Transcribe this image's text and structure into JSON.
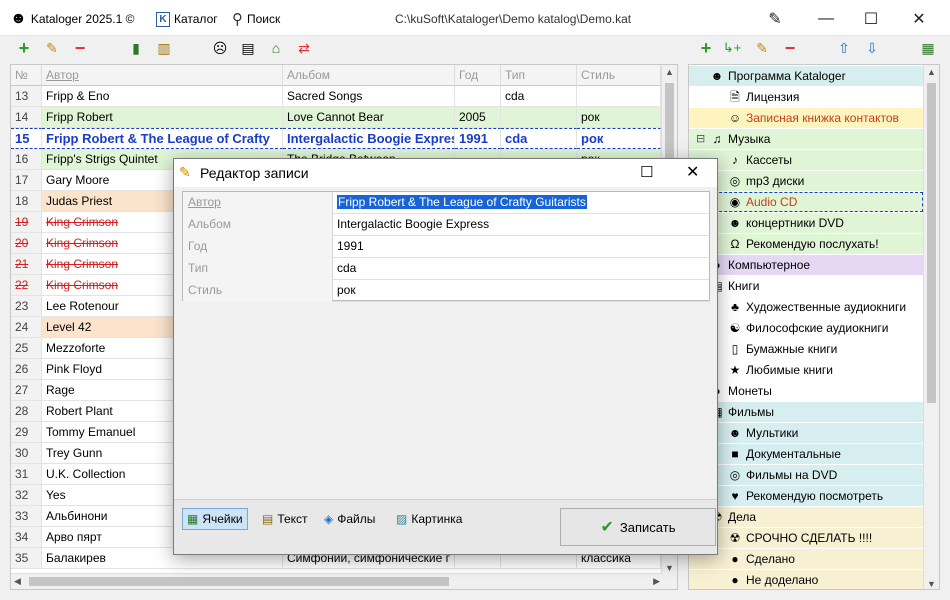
{
  "titlebar": {
    "app_name": "Kataloger 2025.1 ©",
    "catalog_label": "Каталог",
    "search_label": "Поиск",
    "path": "C:\\kuSoft\\Kataloger\\Demo katalog\\Demo.kat"
  },
  "grid": {
    "columns": [
      "№",
      "Автор",
      "Альбом",
      "Год",
      "Тип",
      "Стиль"
    ],
    "rows": [
      {
        "n": "13",
        "author": "Fripp & Eno",
        "album": "Sacred Songs",
        "year": "",
        "type": "cda",
        "style": "",
        "bg": "#ffffff",
        "strike": false
      },
      {
        "n": "14",
        "author": "Fripp Robert",
        "album": "Love Cannot Bear",
        "year": "2005",
        "type": "",
        "style": "рок",
        "bg": "#dff5d6",
        "strike": false
      },
      {
        "n": "15",
        "author": "Fripp Robert & The League of Crafty",
        "album": "Intergalactic Boogie Expres",
        "year": "1991",
        "type": "cda",
        "style": "рок",
        "bg": "#ffffff",
        "strike": false,
        "current": true
      },
      {
        "n": "16",
        "author": "Fripp's Strigs Quintet",
        "album": "The Bridge Between",
        "year": "",
        "type": "",
        "style": "рок",
        "bg": "#dff5d6",
        "strike": false
      },
      {
        "n": "17",
        "author": "Gary Moore",
        "album": "",
        "year": "",
        "type": "",
        "style": "",
        "bg": "#ffffff",
        "strike": false
      },
      {
        "n": "18",
        "author": "Judas Priest",
        "album": "",
        "year": "",
        "type": "",
        "style": "",
        "bg": "#fbe3cc",
        "strike": false
      },
      {
        "n": "19",
        "author": "King Crimson",
        "album": "",
        "year": "",
        "type": "",
        "style": "",
        "bg": "#ffffff",
        "strike": true
      },
      {
        "n": "20",
        "author": "King Crimson",
        "album": "",
        "year": "",
        "type": "",
        "style": "",
        "bg": "#ffffff",
        "strike": true
      },
      {
        "n": "21",
        "author": "King Crimson",
        "album": "",
        "year": "",
        "type": "",
        "style": "",
        "bg": "#ffffff",
        "strike": true
      },
      {
        "n": "22",
        "author": "King Crimson",
        "album": "",
        "year": "",
        "type": "",
        "style": "",
        "bg": "#ffffff",
        "strike": true
      },
      {
        "n": "23",
        "author": "Lee Rotenour",
        "album": "",
        "year": "",
        "type": "",
        "style": "",
        "bg": "#ffffff",
        "strike": false
      },
      {
        "n": "24",
        "author": "Level 42",
        "album": "",
        "year": "",
        "type": "",
        "style": "",
        "bg": "#fbe3cc",
        "strike": false
      },
      {
        "n": "25",
        "author": "Mezzoforte",
        "album": "",
        "year": "",
        "type": "",
        "style": "",
        "bg": "#ffffff",
        "strike": false
      },
      {
        "n": "26",
        "author": "Pink Floyd",
        "album": "",
        "year": "",
        "type": "",
        "style": "",
        "bg": "#ffffff",
        "strike": false
      },
      {
        "n": "27",
        "author": "Rage",
        "album": "",
        "year": "",
        "type": "",
        "style": "",
        "bg": "#ffffff",
        "strike": false
      },
      {
        "n": "28",
        "author": "Robert Plant",
        "album": "",
        "year": "",
        "type": "",
        "style": "",
        "bg": "#ffffff",
        "strike": false
      },
      {
        "n": "29",
        "author": "Tommy Emanuel",
        "album": "",
        "year": "",
        "type": "",
        "style": "",
        "bg": "#ffffff",
        "strike": false
      },
      {
        "n": "30",
        "author": "Trey Gunn",
        "album": "",
        "year": "",
        "type": "",
        "style": "",
        "bg": "#ffffff",
        "strike": false
      },
      {
        "n": "31",
        "author": "U.K. Collection",
        "album": "",
        "year": "",
        "type": "",
        "style": "",
        "bg": "#ffffff",
        "strike": false
      },
      {
        "n": "32",
        "author": "Yes",
        "album": "",
        "year": "",
        "type": "",
        "style": "",
        "bg": "#ffffff",
        "strike": false
      },
      {
        "n": "33",
        "author": "Альбинони",
        "album": "",
        "year": "",
        "type": "",
        "style": "",
        "bg": "#ffffff",
        "strike": false
      },
      {
        "n": "34",
        "author": "Арво пярт",
        "album": "",
        "year": "",
        "type": "",
        "style": "",
        "bg": "#ffffff",
        "strike": false
      },
      {
        "n": "35",
        "author": "Балакирев",
        "album": "Симфонии, симфонические г Евгени 2 CD",
        "year": "",
        "type": "",
        "style": "классика",
        "bg": "#ffffff",
        "strike": false
      }
    ]
  },
  "tree": {
    "nodes": [
      {
        "label": "Программа Kataloger",
        "level": 0,
        "icon": "smiley-icon",
        "glyph": "☻",
        "bg": "#d6eef0",
        "color": "#000",
        "expander": ""
      },
      {
        "label": "Лицензия",
        "level": 1,
        "icon": "document-icon",
        "glyph": "🗎",
        "bg": "#ffffff",
        "color": "#000",
        "expander": ""
      },
      {
        "label": "Записная книжка контактов",
        "level": 1,
        "icon": "contact-icon",
        "glyph": "☺",
        "bg": "#fdf4c0",
        "color": "#c5401b",
        "expander": ""
      },
      {
        "label": "Музыка",
        "level": 0,
        "icon": "music-icon",
        "glyph": "♫",
        "bg": "#dff5d6",
        "color": "#000",
        "expander": "⊟"
      },
      {
        "label": "Кассеты",
        "level": 1,
        "icon": "cassette-icon",
        "glyph": "♪",
        "bg": "#dff5d6",
        "color": "#000",
        "expander": ""
      },
      {
        "label": "mp3 диски",
        "level": 1,
        "icon": "disc-icon",
        "glyph": "◎",
        "bg": "#dff5d6",
        "color": "#000",
        "expander": ""
      },
      {
        "label": "Audio CD",
        "level": 1,
        "icon": "cd-icon",
        "glyph": "◉",
        "bg": "#dff5d6",
        "color": "#c5401b",
        "expander": "",
        "selected": true
      },
      {
        "label": "концертники DVD",
        "level": 1,
        "icon": "dvd-icon",
        "glyph": "☻",
        "bg": "#dff5d6",
        "color": "#000",
        "expander": ""
      },
      {
        "label": "Рекомендую послухать!",
        "level": 1,
        "icon": "headphones-icon",
        "glyph": "Ω",
        "bg": "#dff5d6",
        "color": "#000",
        "expander": ""
      },
      {
        "label": "Компьютерное",
        "level": 0,
        "icon": "computer-icon",
        "glyph": "●",
        "bg": "#e6d8f5",
        "color": "#000",
        "expander": ""
      },
      {
        "label": "Книги",
        "level": 0,
        "icon": "books-icon",
        "glyph": "▤",
        "bg": "#ffffff",
        "color": "#000",
        "expander": ""
      },
      {
        "label": "Художественные аудиокниги",
        "level": 1,
        "icon": "tree-icon",
        "glyph": "♣",
        "bg": "#ffffff",
        "color": "#000",
        "expander": ""
      },
      {
        "label": "Философские аудиокниги",
        "level": 1,
        "icon": "philosophy-icon",
        "glyph": "☯",
        "bg": "#ffffff",
        "color": "#000",
        "expander": ""
      },
      {
        "label": "Бумажные книги",
        "level": 1,
        "icon": "paper-book-icon",
        "glyph": "▯",
        "bg": "#ffffff",
        "color": "#000",
        "expander": ""
      },
      {
        "label": "Любимые книги",
        "level": 1,
        "icon": "star-icon",
        "glyph": "★",
        "bg": "#ffffff",
        "color": "#000",
        "expander": ""
      },
      {
        "label": "Монеты",
        "level": 0,
        "icon": "coin-icon",
        "glyph": "●",
        "bg": "#ffffff",
        "color": "#000",
        "expander": ""
      },
      {
        "label": "Фильмы",
        "level": 0,
        "icon": "film-icon",
        "glyph": "▦",
        "bg": "#d6eef0",
        "color": "#000",
        "expander": ""
      },
      {
        "label": "Мультики",
        "level": 1,
        "icon": "mickey-icon",
        "glyph": "☻",
        "bg": "#d6eef0",
        "color": "#000",
        "expander": ""
      },
      {
        "label": "Документальные",
        "level": 1,
        "icon": "camera-icon",
        "glyph": "■",
        "bg": "#d6eef0",
        "color": "#000",
        "expander": ""
      },
      {
        "label": "Фильмы на DVD",
        "level": 1,
        "icon": "dvd-disc-icon",
        "glyph": "◎",
        "bg": "#d6eef0",
        "color": "#000",
        "expander": ""
      },
      {
        "label": "Рекомендую посмотреть",
        "level": 1,
        "icon": "heart-icon",
        "glyph": "♥",
        "bg": "#d6eef0",
        "color": "#000",
        "expander": ""
      },
      {
        "label": "Дела",
        "level": 0,
        "icon": "radiation-icon",
        "glyph": "☢",
        "bg": "#f8f0d2",
        "color": "#000",
        "expander": ""
      },
      {
        "label": "СРОЧНО СДЕЛАТЬ !!!!",
        "level": 1,
        "icon": "urgent-icon",
        "glyph": "☢",
        "bg": "#f8f0d2",
        "color": "#000",
        "expander": ""
      },
      {
        "label": "Сделано",
        "level": 1,
        "icon": "done-icon",
        "glyph": "●",
        "bg": "#f8f0d2",
        "color": "#000",
        "expander": ""
      },
      {
        "label": "Не доделано",
        "level": 1,
        "icon": "undone-icon",
        "glyph": "●",
        "bg": "#f8f0d2",
        "color": "#000",
        "expander": ""
      }
    ]
  },
  "dialog": {
    "title": "Редактор записи",
    "fields": [
      {
        "label": "Автор",
        "value": "Fripp Robert & The League of Crafty Guitarists",
        "selected": true
      },
      {
        "label": "Альбом",
        "value": "Intergalactic Boogie Express",
        "selected": false
      },
      {
        "label": "Год",
        "value": "1991",
        "selected": false
      },
      {
        "label": "Тип",
        "value": "cda",
        "selected": false
      },
      {
        "label": "Стиль",
        "value": "рок",
        "selected": false
      }
    ],
    "tabs": [
      {
        "label": "Ячейки",
        "icon": "cells-icon",
        "active": true
      },
      {
        "label": "Текст",
        "icon": "text-icon",
        "active": false
      },
      {
        "label": "Файлы",
        "icon": "files-icon",
        "active": false
      },
      {
        "label": "Картинка",
        "icon": "picture-icon",
        "active": false
      }
    ],
    "save_label": "Записать"
  },
  "colors": {
    "accent": "#1664d8",
    "current_row_text": "#1a3cc8",
    "deleted_text": "#d21f1f"
  }
}
